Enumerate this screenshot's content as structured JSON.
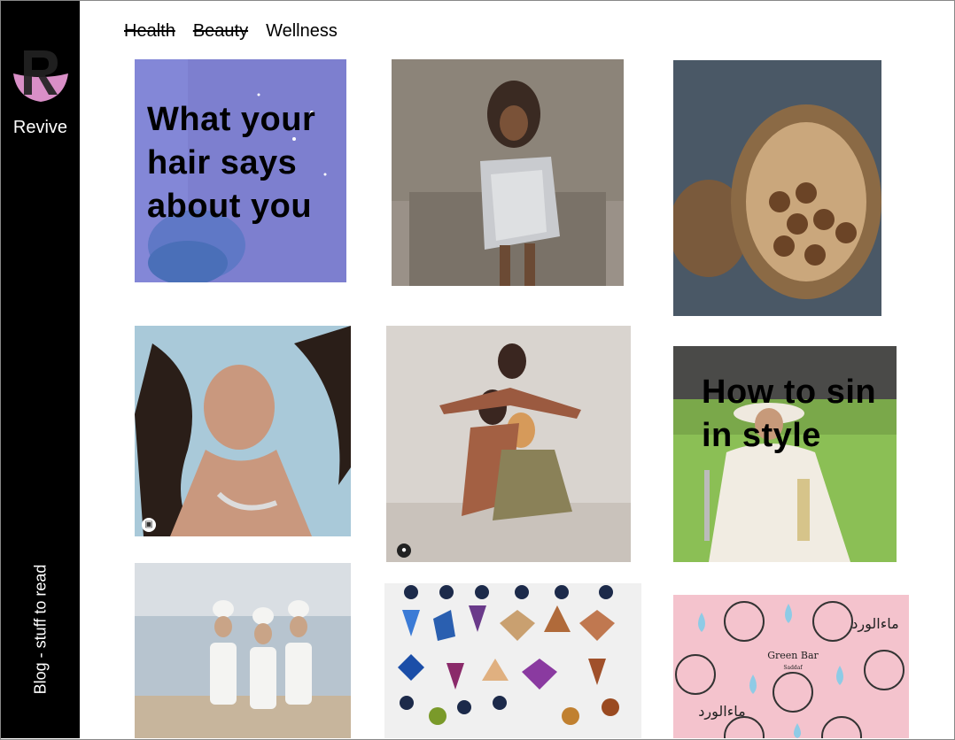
{
  "app": {
    "brand": "Revive",
    "tagline": "Blog - stuff to read"
  },
  "colors": {
    "sidebar": "#000000",
    "logo_pink": "#d98fc7",
    "overlay_text": "#000000"
  },
  "nav": {
    "items": [
      {
        "label": "Health",
        "struck": true
      },
      {
        "label": "Beauty",
        "struck": true
      },
      {
        "label": "Wellness",
        "struck": false
      }
    ]
  },
  "tiles": {
    "hair": {
      "title_line1": "What your",
      "title_line2": "hair says",
      "title_line3": "about you"
    },
    "style": {
      "title_line1": "How to sin",
      "title_line2": "in style"
    },
    "poster": {
      "arabic_text": "ماءالورد",
      "brand_line": "Green Bar",
      "brand_sub": "Saddaf"
    }
  },
  "icons": {
    "logo": "r-logo-icon",
    "bag": "shopping-bag-icon",
    "person": "person-icon"
  }
}
